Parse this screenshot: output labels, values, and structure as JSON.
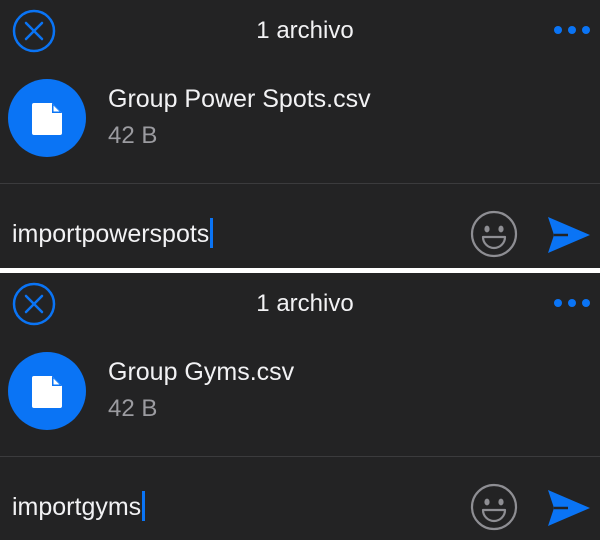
{
  "panels": [
    {
      "title": "1 archivo",
      "close_icon": "close-circle-icon",
      "more_icon": "more-horizontal-icon",
      "file": {
        "name": "Group Power Spots.csv",
        "size": "42 B",
        "icon": "document-icon"
      },
      "message": "importpowerspots",
      "emoji_icon": "smiley-icon",
      "send_icon": "send-icon"
    },
    {
      "title": "1 archivo",
      "close_icon": "close-circle-icon",
      "more_icon": "more-horizontal-icon",
      "file": {
        "name": "Group Gyms.csv",
        "size": "42 B",
        "icon": "document-icon"
      },
      "message": "importgyms",
      "emoji_icon": "smiley-icon",
      "send_icon": "send-icon"
    }
  ],
  "colors": {
    "background": "#232324",
    "accent": "#0a74f5",
    "primary_text": "#f2f2f4",
    "secondary_text": "#9b9ba0",
    "separator": "#ffffff"
  }
}
